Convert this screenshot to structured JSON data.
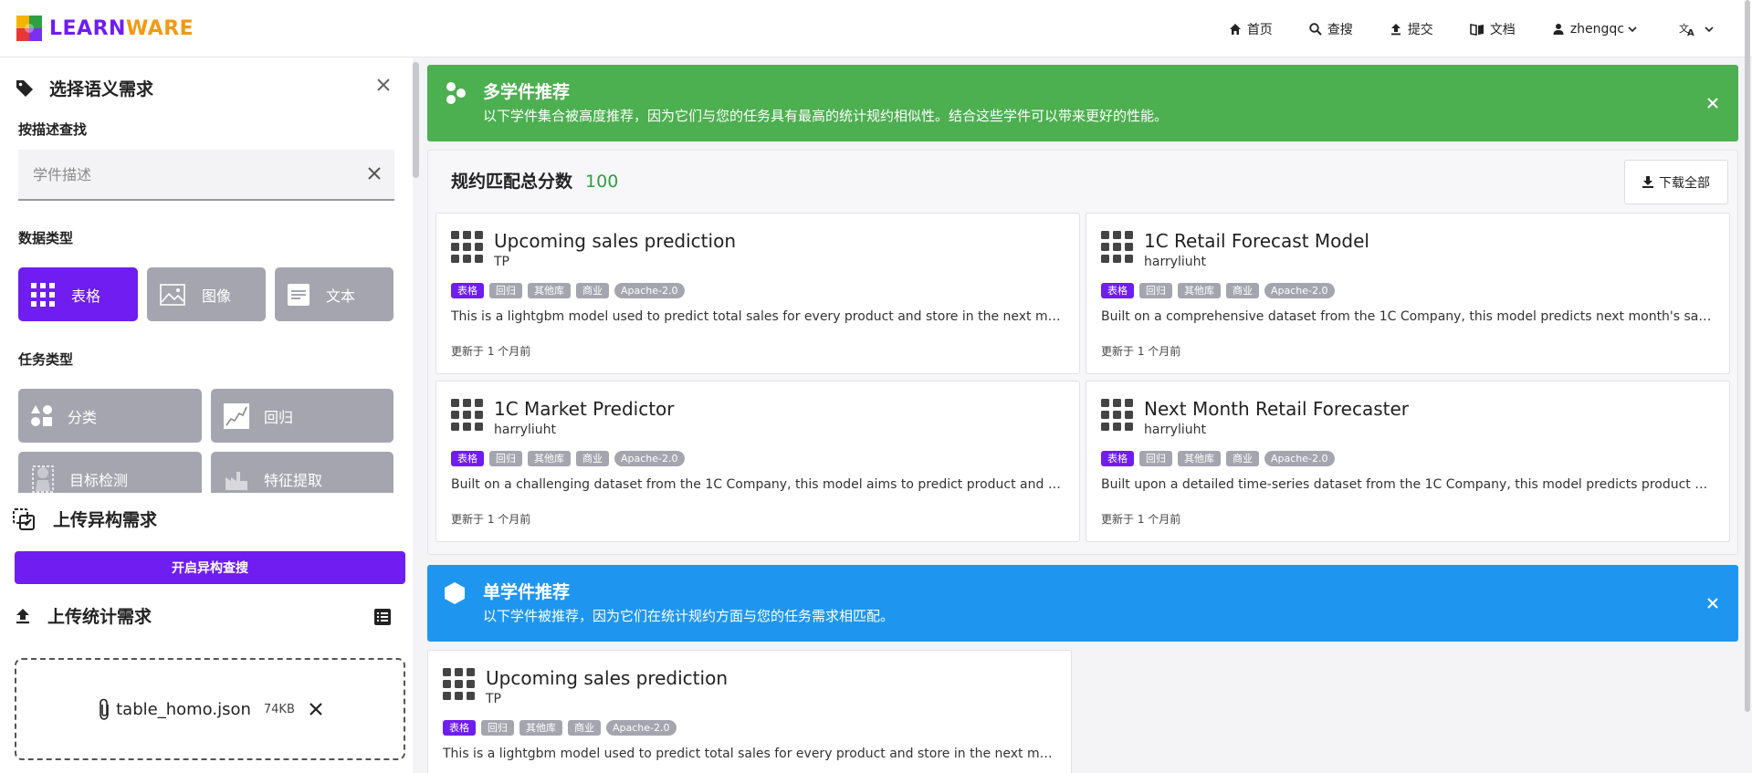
{
  "topbar": {
    "logo_part1": "LEARN",
    "logo_part2": "WARE",
    "nav": [
      {
        "label": "首页",
        "icon": "home-icon"
      },
      {
        "label": "查搜",
        "icon": "search-icon"
      },
      {
        "label": "提交",
        "icon": "upload-icon"
      },
      {
        "label": "文档",
        "icon": "book-icon"
      },
      {
        "label": "zhengqc",
        "icon": "user-icon"
      },
      {
        "label": "",
        "icon": "translate-icon"
      }
    ]
  },
  "sidebar": {
    "semantic_title": "选择语义需求",
    "by_desc_label": "按描述查找",
    "desc_placeholder": "学件描述",
    "data_type_label": "数据类型",
    "data_types": [
      "表格",
      "图像",
      "文本"
    ],
    "task_type_label": "任务类型",
    "task_types": [
      "分类",
      "回归",
      "目标检测",
      "特征提取"
    ],
    "hetero_title": "上传异构需求",
    "hetero_button": "开启异构查搜",
    "stat_title": "上传统计需求",
    "file_name": "table_homo.json",
    "file_size": "74KB"
  },
  "main": {
    "multi_banner": {
      "title": "多学件推荐",
      "subtitle": "以下学件集合被高度推荐，因为它们与您的任务具有最高的统计规约相似性。结合这些学件可以带来更好的性能。",
      "color": "#4caf50"
    },
    "score_label": "规约匹配总分数",
    "score_value": "100",
    "download_all": "下载全部",
    "cards": [
      {
        "title": "Upcoming sales prediction",
        "author": "TP",
        "tags": [
          "表格",
          "回归",
          "其他库",
          "商业",
          "Apache-2.0"
        ],
        "desc": "This is a lightgbm model used to predict total sales for every product and store in the next month, based on historical sales data",
        "updated": "更新于 1 个月前"
      },
      {
        "title": "1C Retail Forecast Model",
        "author": "harryliuht",
        "tags": [
          "表格",
          "回归",
          "其他库",
          "商业",
          "Apache-2.0"
        ],
        "desc": "Built on a comprehensive dataset from the 1C Company, this model predicts next month's sales for every product and store",
        "updated": "更新于 1 个月前"
      },
      {
        "title": "1C Market Predictor",
        "author": "harryliuht",
        "tags": [
          "表格",
          "回归",
          "其他库",
          "商业",
          "Apache-2.0"
        ],
        "desc": "Built on a challenging dataset from the 1C Company, this model aims to predict product and store sales for the next month",
        "updated": "更新于 1 个月前"
      },
      {
        "title": "Next Month Retail Forecaster",
        "author": "harryliuht",
        "tags": [
          "表格",
          "回归",
          "其他库",
          "商业",
          "Apache-2.0"
        ],
        "desc": "Built upon a detailed time-series dataset from the 1C Company, this model predicts product and store sales for the next month",
        "updated": "更新于 1 个月前"
      }
    ],
    "single_banner": {
      "title": "单学件推荐",
      "subtitle": "以下学件被推荐，因为它们在统计规约方面与您的任务需求相匹配。",
      "color": "#1e96f0"
    },
    "single_cards": [
      {
        "title": "Upcoming sales prediction",
        "author": "TP",
        "tags": [
          "表格",
          "回归",
          "其他库",
          "商业",
          "Apache-2.0"
        ],
        "desc": "This is a lightgbm model used to predict total sales for every product and store in the next month, based on historical sales data"
      }
    ]
  }
}
